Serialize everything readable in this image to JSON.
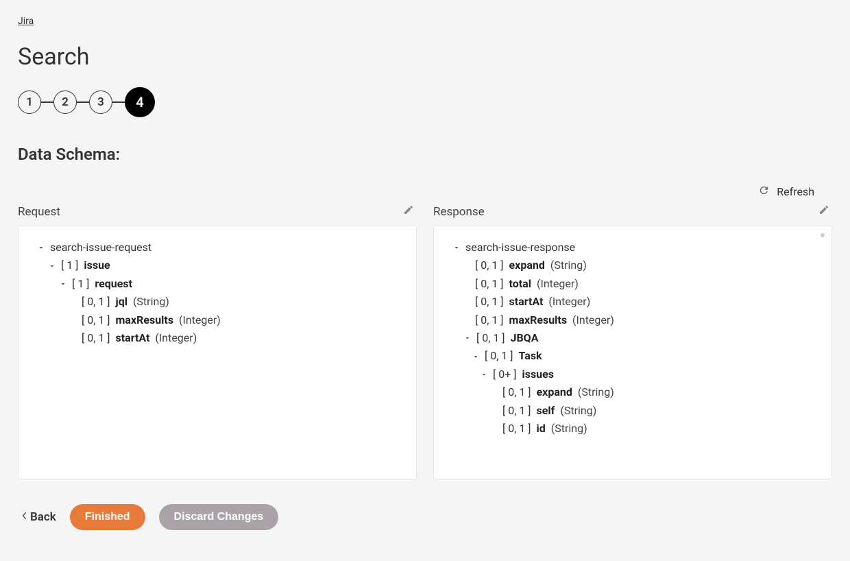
{
  "breadcrumb": "Jira",
  "page_title": "Search",
  "stepper": {
    "steps": [
      "1",
      "2",
      "3",
      "4"
    ],
    "active_index": 3
  },
  "section_heading": "Data Schema:",
  "refresh_label": "Refresh",
  "panels": {
    "request": {
      "title": "Request",
      "root": "search-issue-request",
      "fields": {
        "issue": {
          "card": "[ 1 ]",
          "name": "issue"
        },
        "request": {
          "card": "[ 1 ]",
          "name": "request"
        },
        "jql": {
          "card": "[ 0, 1 ]",
          "name": "jql",
          "type": "(String)"
        },
        "maxResults": {
          "card": "[ 0, 1 ]",
          "name": "maxResults",
          "type": "(Integer)"
        },
        "startAt": {
          "card": "[ 0, 1 ]",
          "name": "startAt",
          "type": "(Integer)"
        }
      }
    },
    "response": {
      "title": "Response",
      "root": "search-issue-response",
      "fields": {
        "expand": {
          "card": "[ 0, 1 ]",
          "name": "expand",
          "type": "(String)"
        },
        "total": {
          "card": "[ 0, 1 ]",
          "name": "total",
          "type": "(Integer)"
        },
        "startAt": {
          "card": "[ 0, 1 ]",
          "name": "startAt",
          "type": "(Integer)"
        },
        "maxResults": {
          "card": "[ 0, 1 ]",
          "name": "maxResults",
          "type": "(Integer)"
        },
        "jbqa": {
          "card": "[ 0, 1 ]",
          "name": "JBQA"
        },
        "task": {
          "card": "[ 0, 1 ]",
          "name": "Task"
        },
        "issues": {
          "card": "[ 0+ ]",
          "name": "issues"
        },
        "iexpand": {
          "card": "[ 0, 1 ]",
          "name": "expand",
          "type": "(String)"
        },
        "self": {
          "card": "[ 0, 1 ]",
          "name": "self",
          "type": "(String)"
        },
        "id": {
          "card": "[ 0, 1 ]",
          "name": "id",
          "type": "(String)"
        }
      }
    }
  },
  "footer": {
    "back": "Back",
    "finished": "Finished",
    "discard": "Discard Changes"
  }
}
